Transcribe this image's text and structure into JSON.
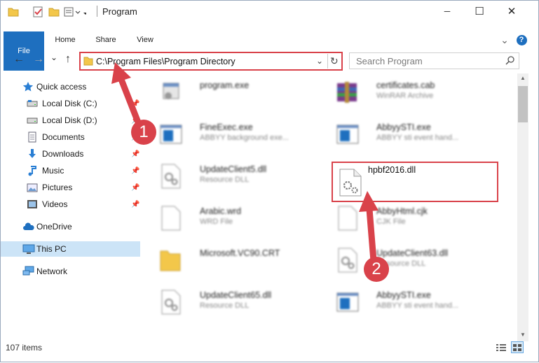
{
  "window": {
    "title": "Program",
    "minimize_glyph": "─",
    "maximize_glyph": "☐",
    "close_glyph": "✕"
  },
  "ribbon": {
    "tabs": [
      "File",
      "Home",
      "Share",
      "View"
    ],
    "help_glyph": "?",
    "expand_glyph": "⌄"
  },
  "navigation": {
    "back_glyph": "←",
    "forward_glyph": "→",
    "up_glyph": "↑",
    "recent_glyph": "⌄",
    "address": "C:\\Program Files\\Program Directory",
    "search_placeholder": "Search Program"
  },
  "sidebar": {
    "items": [
      {
        "label": "Quick access",
        "icon": "star-icon",
        "pinned": false
      },
      {
        "label": "Local Disk (C:)",
        "icon": "drive-icon",
        "pinned": true
      },
      {
        "label": "Local Disk (D:)",
        "icon": "drive-icon",
        "pinned": true
      },
      {
        "label": "Documents",
        "icon": "documents-icon",
        "pinned": true
      },
      {
        "label": "Downloads",
        "icon": "downloads-icon",
        "pinned": true
      },
      {
        "label": "Music",
        "icon": "music-icon",
        "pinned": true
      },
      {
        "label": "Pictures",
        "icon": "pictures-icon",
        "pinned": true
      },
      {
        "label": "Videos",
        "icon": "videos-icon",
        "pinned": true
      },
      {
        "label": "OneDrive",
        "icon": "cloud-icon",
        "pinned": false
      },
      {
        "label": "This PC",
        "icon": "pc-icon",
        "pinned": false,
        "selected": true
      },
      {
        "label": "Network",
        "icon": "network-icon",
        "pinned": false
      }
    ]
  },
  "files": [
    {
      "name": "program.exe",
      "type": "",
      "icon": "exe-icon"
    },
    {
      "name": "certificates.cab",
      "type": "WinRAR Archive",
      "icon": "archive-icon"
    },
    {
      "name": "FineExec.exe",
      "type": "ABBYY background exe...",
      "icon": "app-icon"
    },
    {
      "name": "AbbyySTI.exe",
      "type": "ABBYY sti event hand...",
      "icon": "app-icon"
    },
    {
      "name": "UpdateClient5.dll",
      "type": "Resource DLL",
      "icon": "dll-icon"
    },
    {
      "name": "hpbf2016.dll",
      "type": "",
      "icon": "dll-icon",
      "highlighted": true
    },
    {
      "name": "Arabic.wrd",
      "type": "WRD File",
      "icon": "file-icon"
    },
    {
      "name": "AbbyHtml.cjk",
      "type": "CJK File",
      "icon": "file-icon"
    },
    {
      "name": "Microsoft.VC90.CRT",
      "type": "",
      "icon": "folder-icon"
    },
    {
      "name": "UpdateClient63.dll",
      "type": "Resource DLL",
      "icon": "dll-icon"
    },
    {
      "name": "UpdateClient65.dll",
      "type": "Resource DLL",
      "icon": "dll-icon"
    },
    {
      "name": "AbbyySTI.exe",
      "type": "ABBYY sti event hand...",
      "icon": "app-icon"
    }
  ],
  "status": {
    "item_count": "107 items"
  },
  "annotations": {
    "step1": "1",
    "step2": "2"
  },
  "colors": {
    "accent": "#1e6fbf",
    "annotation_red": "#d9424a",
    "selected_bg": "#cce4f7"
  }
}
